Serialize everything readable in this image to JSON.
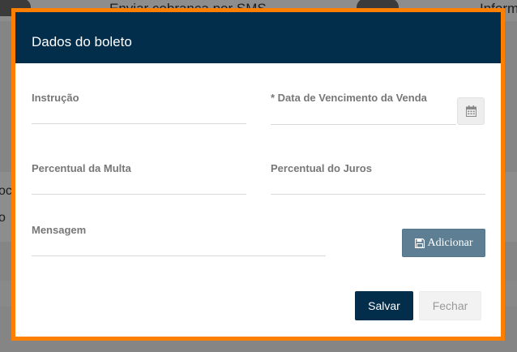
{
  "background": {
    "sms_label": "Enviar cobrança por SMS",
    "right_label": "Inform",
    "left_fragment_1": "oc",
    "left_fragment_2": "o"
  },
  "modal": {
    "title": "Dados do boleto",
    "fields": {
      "instrucao": {
        "label": "Instrução",
        "value": ""
      },
      "vencimento": {
        "label": "* Data de Vencimento da Venda",
        "value": ""
      },
      "multa": {
        "label": "Percentual da Multa",
        "value": ""
      },
      "juros": {
        "label": "Percentual do Juros",
        "value": ""
      },
      "mensagem": {
        "label": "Mensagem",
        "value": ""
      }
    },
    "buttons": {
      "add_label": "Adicionar",
      "save_label": "Salvar",
      "close_label": "Fechar"
    }
  },
  "colors": {
    "header": "#022d4b",
    "border_accent": "#ff8000",
    "add_button": "#5e7f93"
  }
}
